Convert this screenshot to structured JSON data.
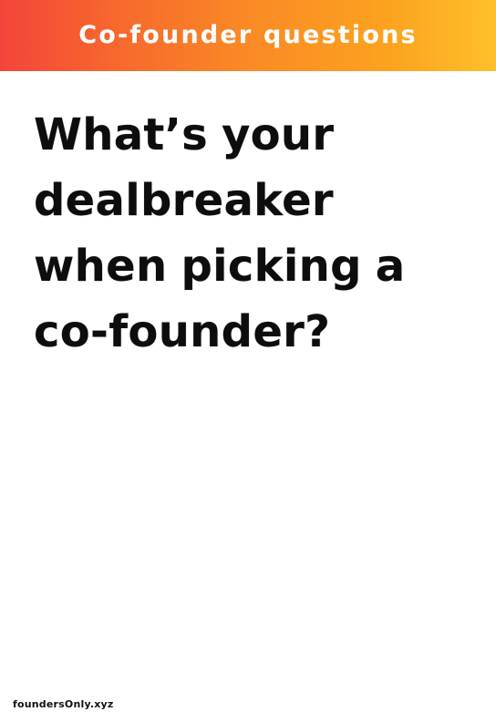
{
  "header": {
    "title": "Co-founder questions",
    "gradient_start": "#f4443a",
    "gradient_end": "#fec02a"
  },
  "card": {
    "question": "What’s your dealbreaker when picking a co-founder?"
  },
  "footer": {
    "brand": "foundersOnly.xyz"
  }
}
